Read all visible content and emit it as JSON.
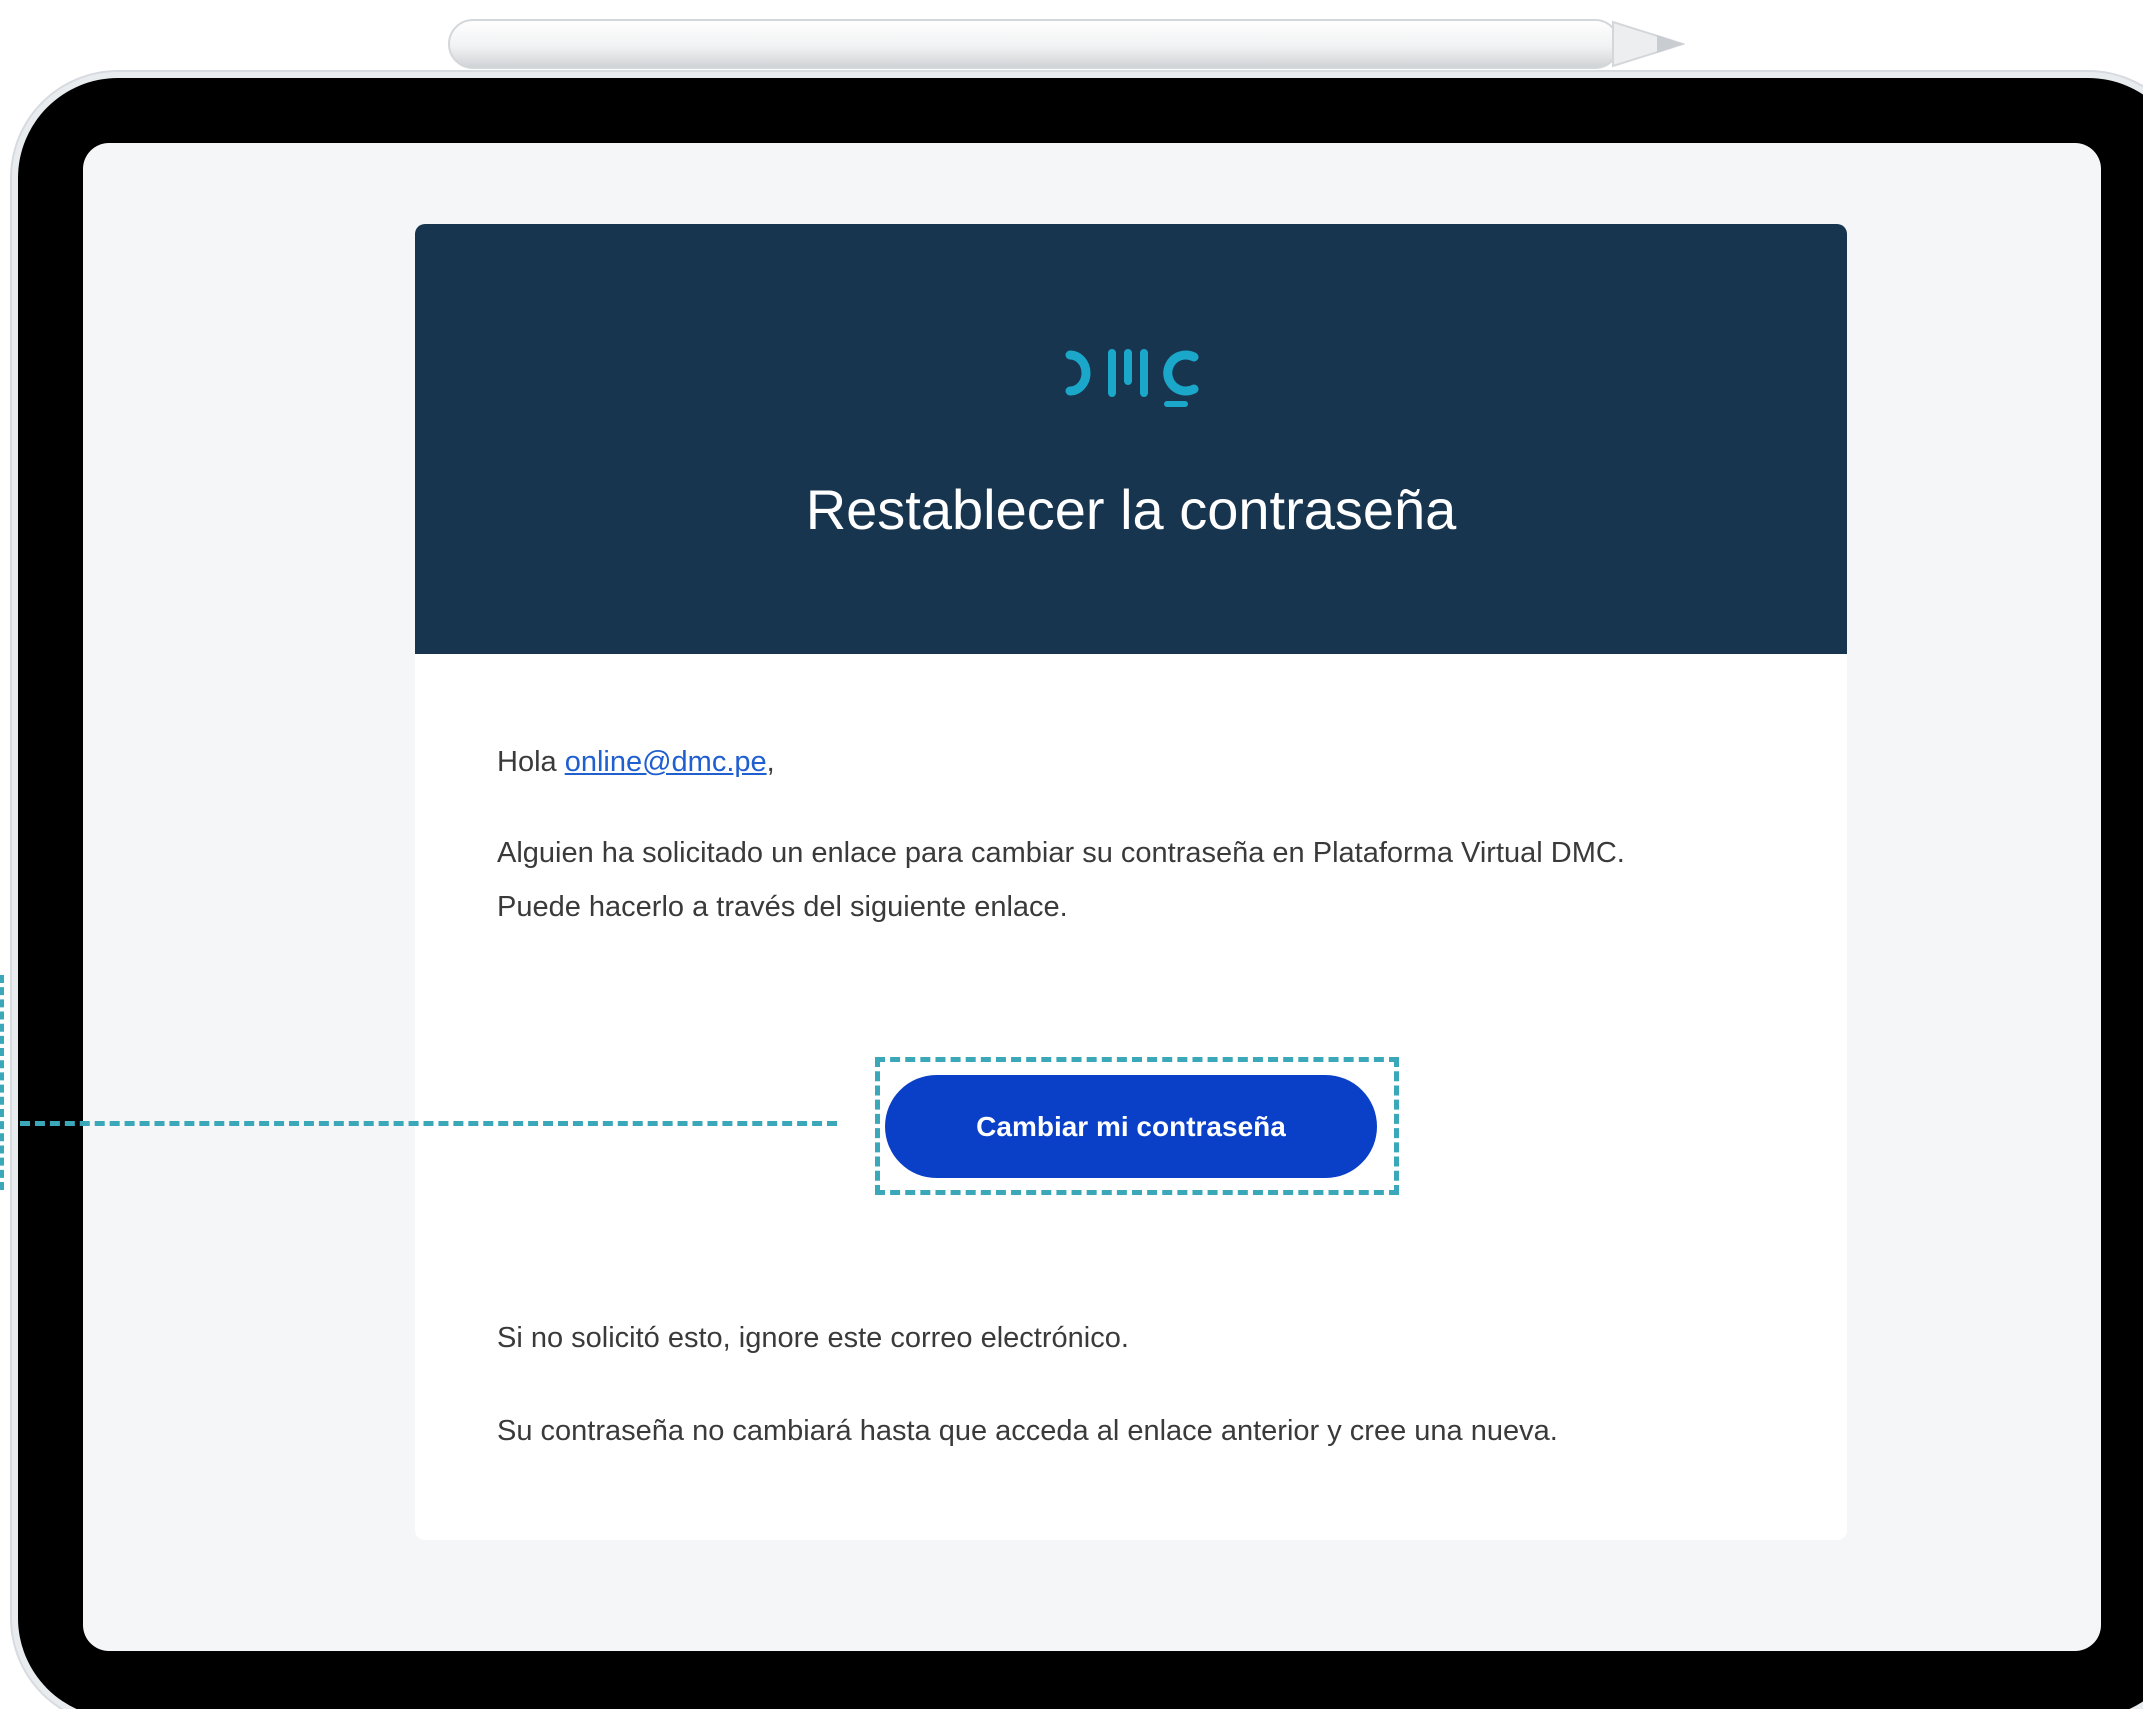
{
  "email": {
    "brand_logo_icon": "dmc-logo-icon",
    "title": "Restablecer la contraseña",
    "greeting_prefix": "Hola ",
    "recipient_email": "online@dmc.pe",
    "greeting_suffix": ",",
    "paragraph_1": "Alguien ha solicitado un enlace para cambiar su contraseña en Plataforma Virtual DMC.",
    "paragraph_2": "Puede hacerlo a través del siguiente enlace.",
    "button_label": "Cambiar mi contraseña",
    "paragraph_3": "Si no solicitó esto, ignore este correo electrónico.",
    "paragraph_4": "Su contraseña no cambiará hasta que acceda al enlace anterior y cree una nueva."
  },
  "colors": {
    "header_bg": "#17354e",
    "button_bg": "#0a3fc7",
    "link": "#1f5fd0",
    "logo_teal": "#1aa7c9",
    "highlight_dash": "#3aa8b8"
  },
  "decor": {
    "device": "tablet-frame",
    "stylus": "stylus-pencil-icon"
  }
}
